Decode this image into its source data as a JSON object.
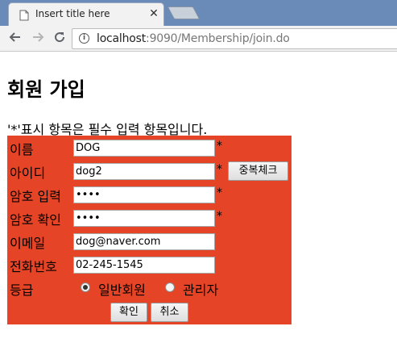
{
  "browser": {
    "tab_title": "Insert title here",
    "tab_close_glyph": "✕",
    "url_host": "localhost",
    "url_path": ":9090/Membership/join.do",
    "icons": {
      "tab_page": "page-icon",
      "back": "back-arrow-icon",
      "forward": "forward-arrow-icon",
      "reload": "reload-icon",
      "info": "info-icon"
    }
  },
  "page": {
    "title": "회원 가입",
    "notice": "'*'표시 항목은 필수 입력 항목입니다."
  },
  "form": {
    "background_color": "#e54526",
    "required_mark": "*",
    "name": {
      "label": "이름",
      "value": "DOG"
    },
    "userid": {
      "label": "아이디",
      "value": "dog2",
      "check_button": "중복체크"
    },
    "password": {
      "label": "암호 입력",
      "value": "••••"
    },
    "password_confirm": {
      "label": "암호 확인",
      "value": "••••"
    },
    "email": {
      "label": "이메일",
      "value": "dog@naver.com"
    },
    "phone": {
      "label": "전화번호",
      "value": "02-245-1545"
    },
    "grade": {
      "label": "등급",
      "options": [
        {
          "label": "일반회원",
          "selected": true
        },
        {
          "label": "관리자",
          "selected": false
        }
      ]
    },
    "submit_label": "확인",
    "reset_label": "취소"
  }
}
